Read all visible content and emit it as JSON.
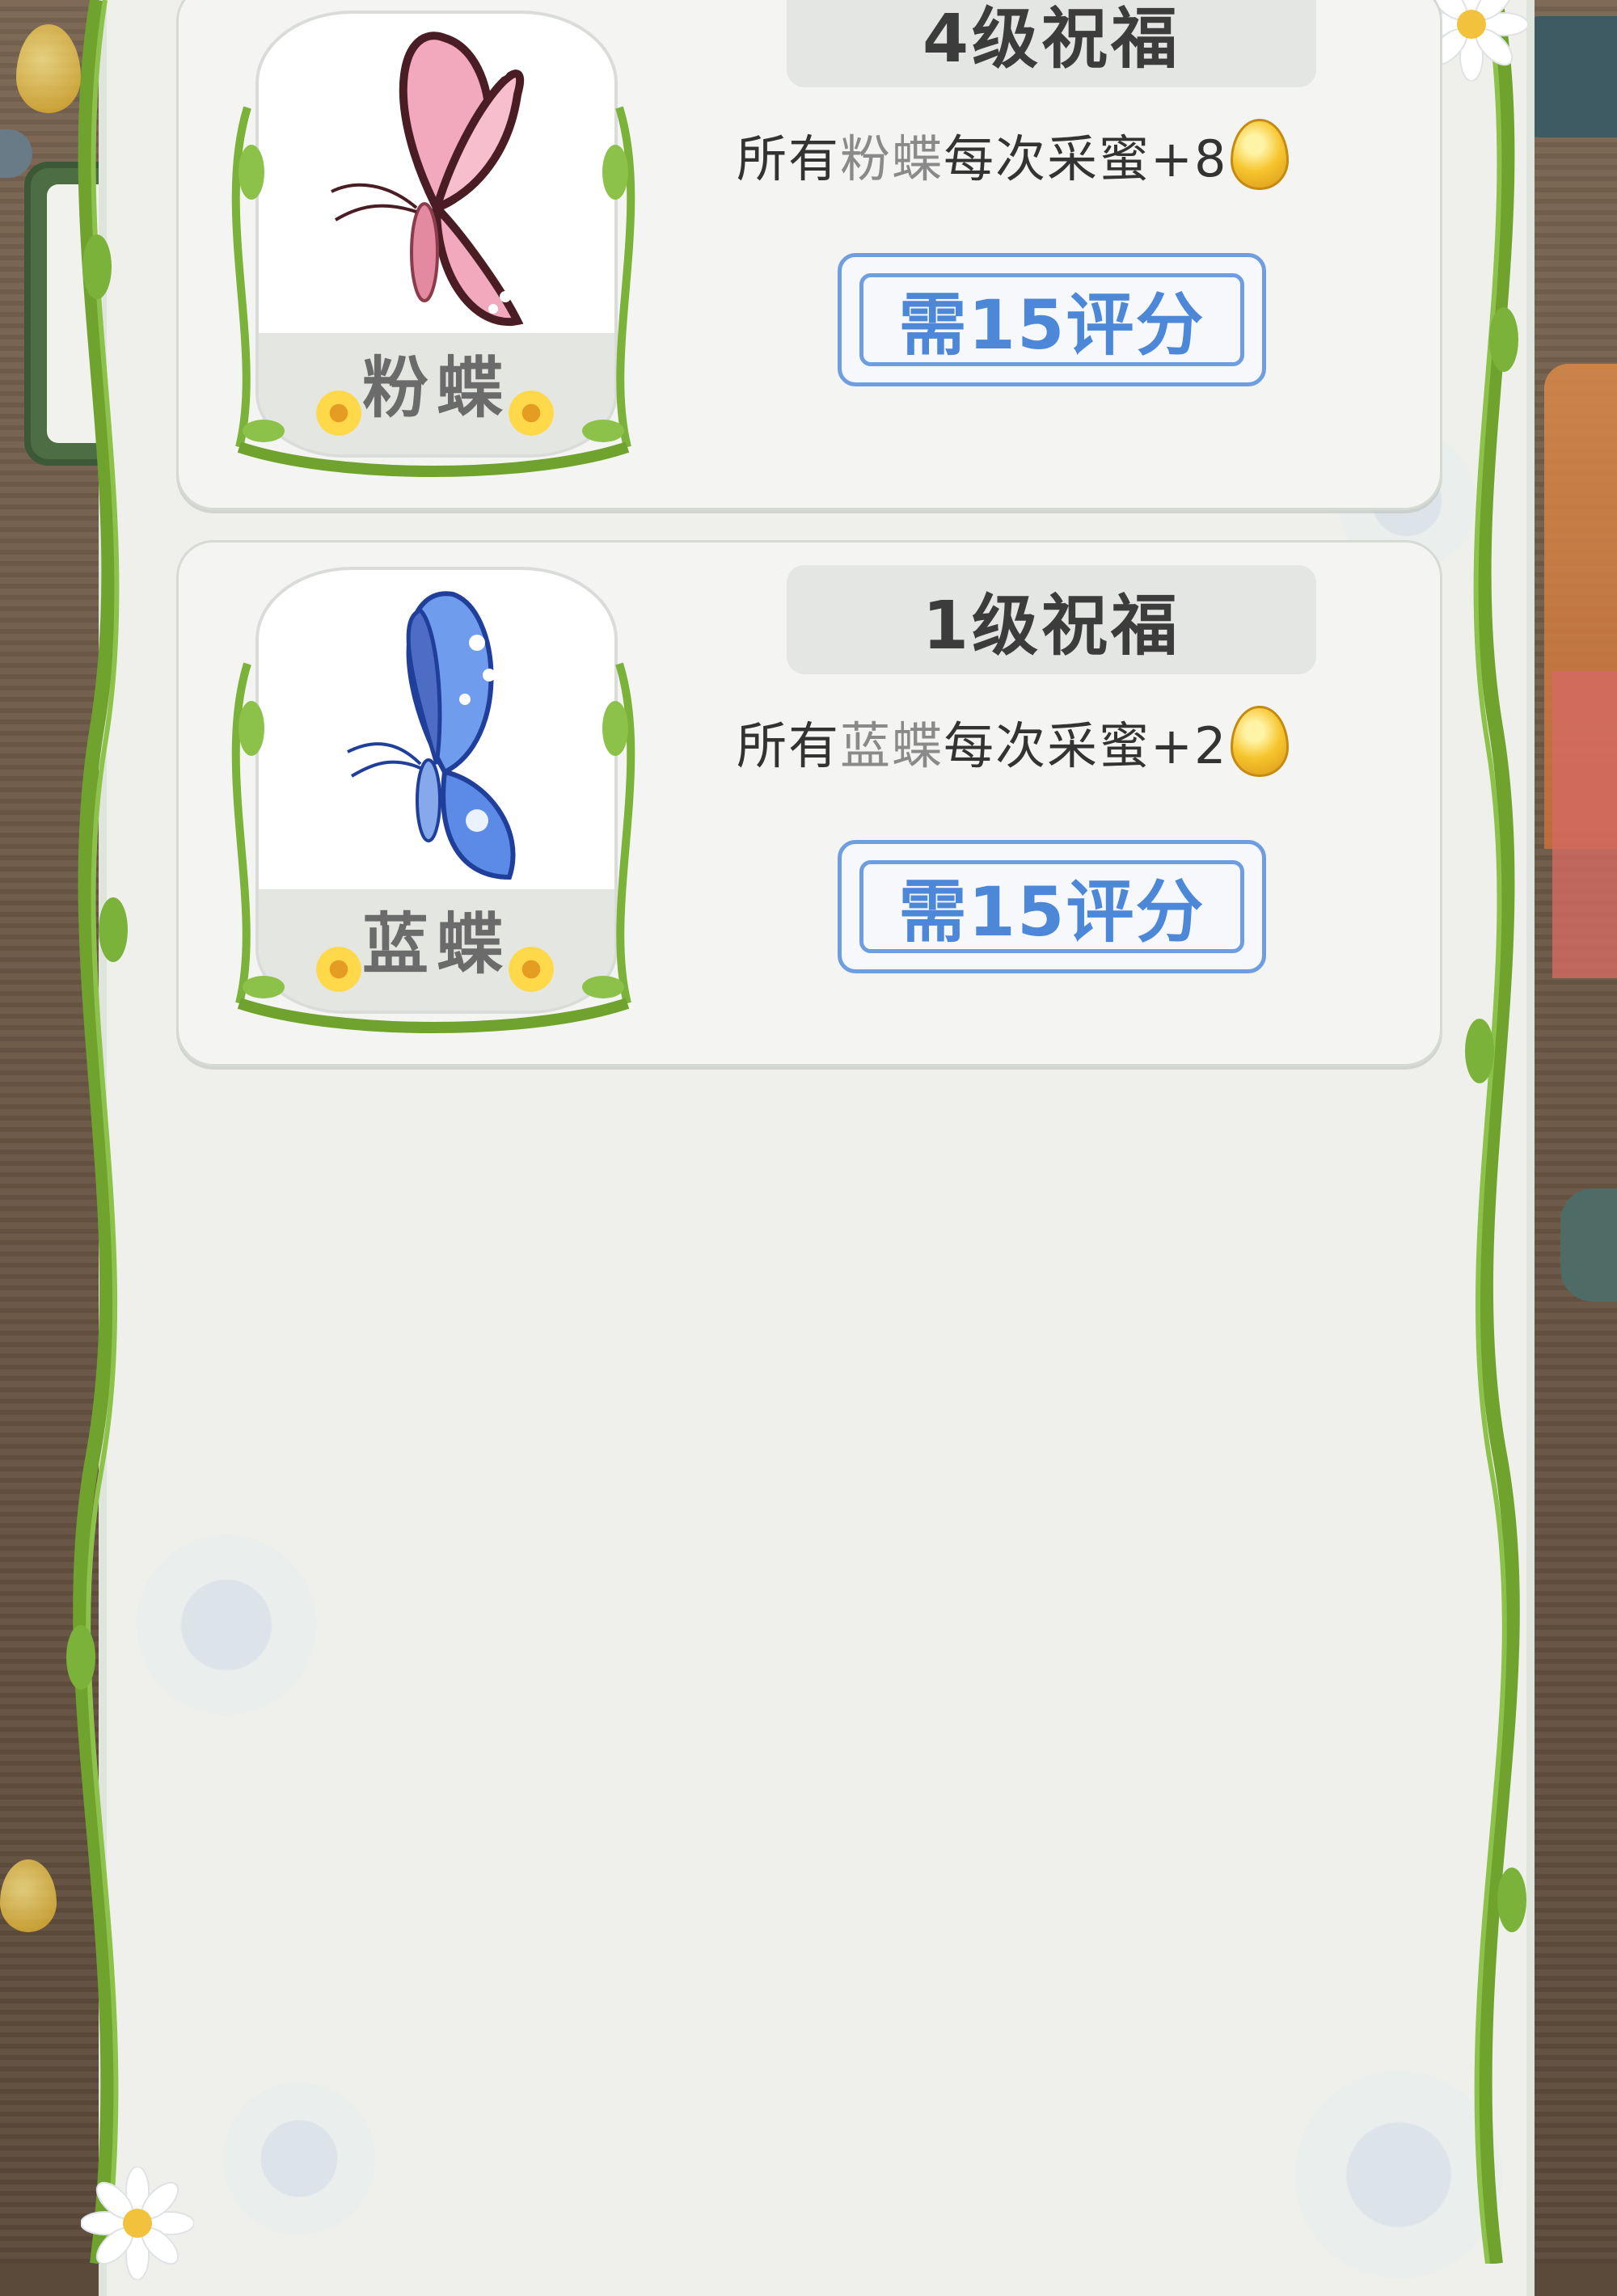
{
  "cards": [
    {
      "portrait_name": "粉蝶",
      "title": "4级祝福",
      "desc_prefix": "所有",
      "desc_name": "粉蝶",
      "desc_suffix": "每次采蜜+8",
      "button_label": "需15评分",
      "wing_color": "#f2a9bd",
      "wing_edge": "#4a1d24"
    },
    {
      "portrait_name": "蓝蝶",
      "title": "1级祝福",
      "desc_prefix": "所有",
      "desc_name": "蓝蝶",
      "desc_suffix": "每次采蜜+2",
      "button_label": "需15评分",
      "wing_color": "#5b8be6",
      "wing_edge": "#1f3f9a"
    }
  ],
  "icons": [
    "butterfly-pink-icon",
    "butterfly-blue-icon",
    "honey-drop-icon",
    "yellow-flower-icon",
    "vine-border",
    "daisy-decoration"
  ],
  "colors": {
    "panel": "#eff0eb",
    "button_blue": "#4c87d8",
    "vine_green": "#6fa32e",
    "honey": "#f6c52d"
  }
}
